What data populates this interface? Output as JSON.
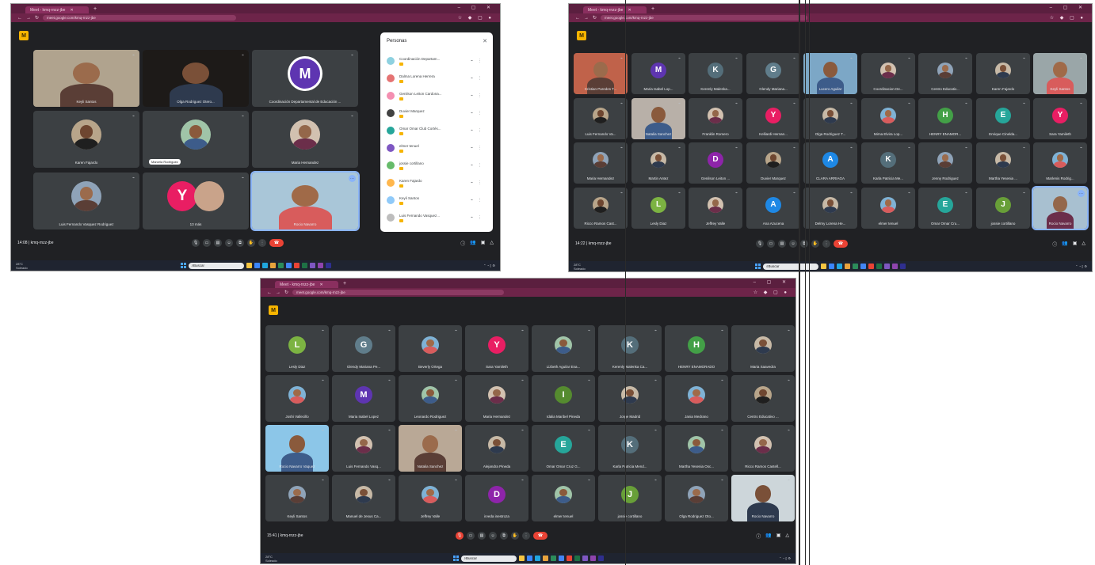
{
  "colors": {
    "meet_bg": "#202124",
    "tile": "#3c4043",
    "browser_frame": "#6d2449",
    "hangup": "#ea4335",
    "accent_blue": "#8ab4f8"
  },
  "browser": {
    "tab_label": "Meet - kmq-rnzz-jbe",
    "url": "meet.google.com/kmq-rnzz-jbe",
    "new_tab": "+",
    "window_controls": "– ▢ ✕"
  },
  "taskbar": {
    "search": "Buscar",
    "weather_1": "28°C",
    "weather_2": "Soleado"
  },
  "s1": {
    "time": "14:08",
    "meeting_code": "kmq-rnzz-jbe",
    "tiles": [
      {
        "name": "Keyli Santos"
      },
      {
        "name": "Olga Rodriguez Otero..."
      },
      {
        "name": "Coordinación Departamental de Educación ...",
        "initial": "M"
      },
      {
        "name": "Karen Fajardo"
      },
      {
        "name": "Marcela Rodríguez"
      },
      {
        "name": "Maria Hernandez"
      },
      {
        "name": "Luis Fernando Vasquez Rodriguez"
      },
      {
        "name": "13 más",
        "initial": "Y"
      },
      {
        "name": "Rocio Navarro"
      }
    ],
    "people_title": "Personas",
    "people": [
      "Coordinación Departam...",
      "Dalma Lorena Herrera",
      "Genilson Leiton Cardona...",
      "Duvier Marquez",
      "Omar Omar Club Cortés...",
      "elmer tenuel",
      "jossie cortillano",
      "Karen Fajardo",
      "Keyli Santos",
      "Luis Fernando Vasquez..."
    ]
  },
  "s2": {
    "time": "14:22",
    "meeting_code": "kmq-rnzz-jbe",
    "tiles": [
      {
        "name": "Cristian Paredes T..."
      },
      {
        "name": "Maria Isabel Lop...",
        "initial": "M"
      },
      {
        "name": "Kerenly Malenka...",
        "initial": "K"
      },
      {
        "name": "Glendy Mariana...",
        "initial": "G"
      },
      {
        "name": "Lucero Aguilar"
      },
      {
        "name": "Coordinacion De..."
      },
      {
        "name": "Centro Educativ..."
      },
      {
        "name": "Karen Fajardo"
      },
      {
        "name": "Keyli Santos"
      },
      {
        "name": "Luis Fernando Va..."
      },
      {
        "name": "Natalia Sanchez"
      },
      {
        "name": "Franklin Romero"
      },
      {
        "name": "Kelliardi Hernan...",
        "initial": "Y"
      },
      {
        "name": "Olga Rodriguez T..."
      },
      {
        "name": "Mirna Elvira Lop..."
      },
      {
        "name": "HENRY ENAMOR...",
        "initial": "H"
      },
      {
        "name": "Enrique Cinelda...",
        "initial": "E"
      },
      {
        "name": "Sara Yamileth",
        "initial": "Y"
      },
      {
        "name": "Maria Hernandez"
      },
      {
        "name": "Martin Antez"
      },
      {
        "name": "Genilson Leiton ...",
        "initial": "D"
      },
      {
        "name": "Duvier Marquez"
      },
      {
        "name": "CLARA ARRIAGA",
        "initial": "A"
      },
      {
        "name": "Karla Patricia Me...",
        "initial": "K"
      },
      {
        "name": "Jenny Rodriguez"
      },
      {
        "name": "Martha Yesenia ..."
      },
      {
        "name": "Marlenis Rodrig..."
      },
      {
        "name": "Ricco Ramos Cast..."
      },
      {
        "name": "Lesly Diaz",
        "initial": "L"
      },
      {
        "name": "Jeffrey Valle"
      },
      {
        "name": "Ana Azucena",
        "initial": "A"
      },
      {
        "name": "Delmy Lorena He..."
      },
      {
        "name": "elmer tenuel"
      },
      {
        "name": "Omar Omar Cru...",
        "initial": "E"
      },
      {
        "name": "jossie cortillano",
        "initial": "J"
      },
      {
        "name": "Rocio Navarro"
      }
    ]
  },
  "s3": {
    "time": "15:41",
    "meeting_code": "kmq-rnzz-jbe",
    "tiles": [
      {
        "name": "Lesly Diaz",
        "initial": "L"
      },
      {
        "name": "Glendy Mariana Pe...",
        "initial": "G"
      },
      {
        "name": "Beverly Ortega"
      },
      {
        "name": "Sara Yamileth",
        "initial": "Y"
      },
      {
        "name": "Lizbeth Aguilar Ena..."
      },
      {
        "name": "Kerenly Malenka Ca...",
        "initial": "K"
      },
      {
        "name": "HENRY ENAMORADO",
        "initial": "H"
      },
      {
        "name": "Maria Saavedra"
      },
      {
        "name": "Joshi Vallecillo"
      },
      {
        "name": "Maria Isabel Lopez",
        "initial": "M"
      },
      {
        "name": "Leonardo Rodriguez"
      },
      {
        "name": "Maria Hernandez"
      },
      {
        "name": "Idalia Maribel Pineda",
        "initial": "I"
      },
      {
        "name": "Jorge Madrid"
      },
      {
        "name": "Jania Medrano"
      },
      {
        "name": "Centro Educativo ..."
      },
      {
        "name": "Rocio Navarro Vaquez"
      },
      {
        "name": "Luis Fernando Vasq..."
      },
      {
        "name": "Natalia Sanchez"
      },
      {
        "name": "Alejandra Pineda"
      },
      {
        "name": "Omar Omar Cruz G...",
        "initial": "E"
      },
      {
        "name": "Karla Patricia Mend...",
        "initial": "K"
      },
      {
        "name": "Martha Yesenia Osc..."
      },
      {
        "name": "Ricco Ramos Castell..."
      },
      {
        "name": "Keyli Santos"
      },
      {
        "name": "Manuel de Jesus Ca..."
      },
      {
        "name": "Jeffrey Valle"
      },
      {
        "name": "irveda inestroza",
        "initial": "D"
      },
      {
        "name": "elmer tenuel"
      },
      {
        "name": "jossie cortillano",
        "initial": "J"
      },
      {
        "name": "Olga Rodriguez Oto..."
      },
      {
        "name": "Rocio Navarro"
      }
    ]
  }
}
